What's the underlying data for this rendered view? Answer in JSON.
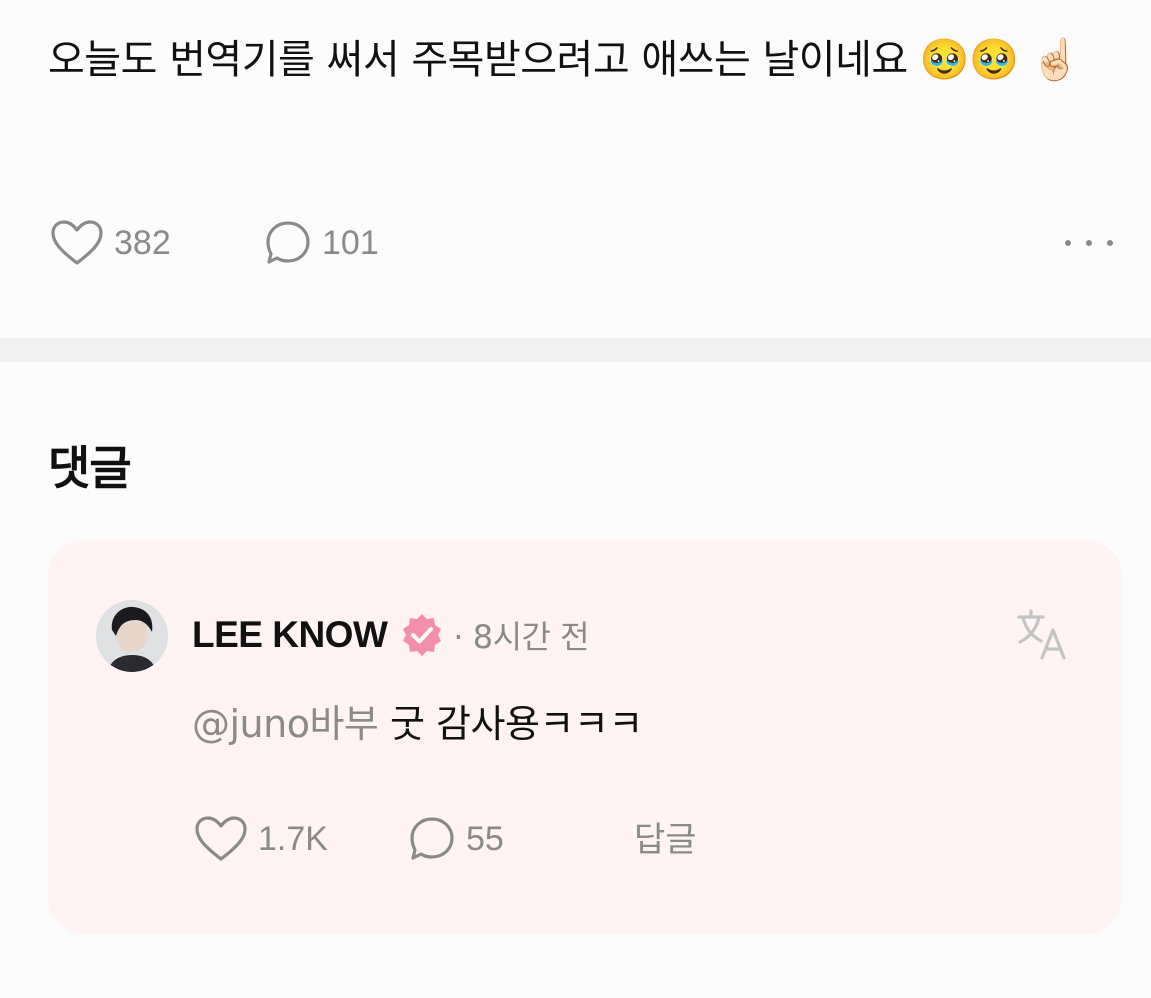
{
  "post": {
    "text": "오늘도 번역기를 써서 주목받으려고 애쓰는 날이네요 🥹🥹 ☝🏻",
    "like_count": "382",
    "comment_count": "101",
    "more_icon": "more-horizontal-icon"
  },
  "comments_section": {
    "title": "댓글"
  },
  "comment": {
    "author": "LEE KNOW",
    "verified_icon": "verified-badge-icon",
    "verified_color": "#f48fab",
    "time": "· 8시간 전",
    "translate_icon": "translate-icon",
    "mention": "@juno바부",
    "body": " 굿 감사용ㅋㅋㅋ",
    "like_count": "1.7K",
    "reply_count": "55",
    "reply_label": "답글"
  },
  "colors": {
    "card_background": "#fff3f3",
    "muted_text": "#8a8a8a",
    "accent_pink": "#f48fab"
  }
}
